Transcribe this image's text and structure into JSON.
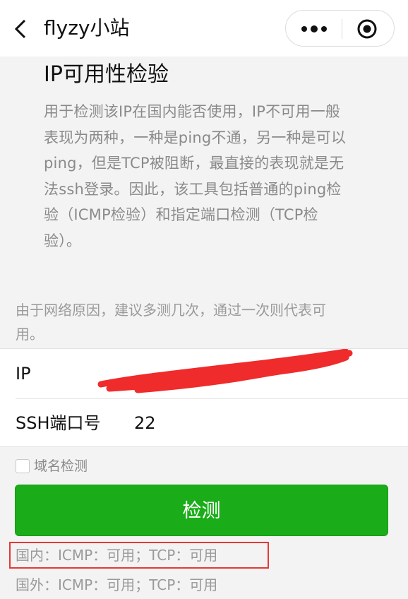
{
  "nav": {
    "title": "flyzy小站"
  },
  "page": {
    "title": "IP可用性检验",
    "intro_lines": [
      "用于检测该IP在国内能否使用，IP不可用一般",
      "表现为两种，一种是ping不通，另一种是可以",
      "ping，但是TCP被阻断，最直接的表现就是无",
      "法ssh登录。因此，该工具包括普通的ping检",
      "验（ICMP检验）和指定端口检测（TCP检",
      "验）。"
    ],
    "tip_lines": [
      "由于网络原因，建议多测几次，通过一次则代表可",
      "用。"
    ]
  },
  "form": {
    "ip_label": "IP",
    "ip_value": "",
    "port_label": "SSH端口号",
    "port_value": "22",
    "domain_check_label": "域名检测",
    "domain_check_checked": false,
    "submit_label": "检测"
  },
  "results": {
    "domestic": "国内：ICMP：可用；TCP：可用",
    "overseas": "国外：ICMP：可用；TCP：可用"
  },
  "colors": {
    "primary_button": "#1aad19",
    "highlight_border": "#e53935",
    "redaction": "#f02b2b"
  }
}
